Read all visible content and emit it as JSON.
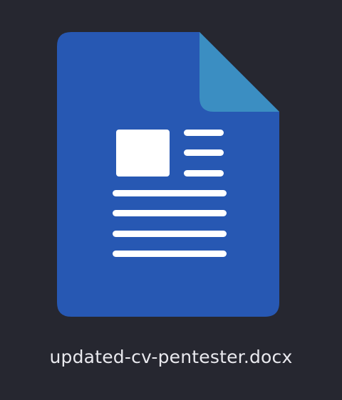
{
  "file": {
    "name": "updated-cv-pentester.docx",
    "type": "docx",
    "icon": "document-icon"
  },
  "colors": {
    "background": "#262730",
    "document_body": "#2758b3",
    "folded_corner": "#3b8ec2",
    "content_lines": "#ffffff",
    "label_text": "#e9e9ee"
  }
}
